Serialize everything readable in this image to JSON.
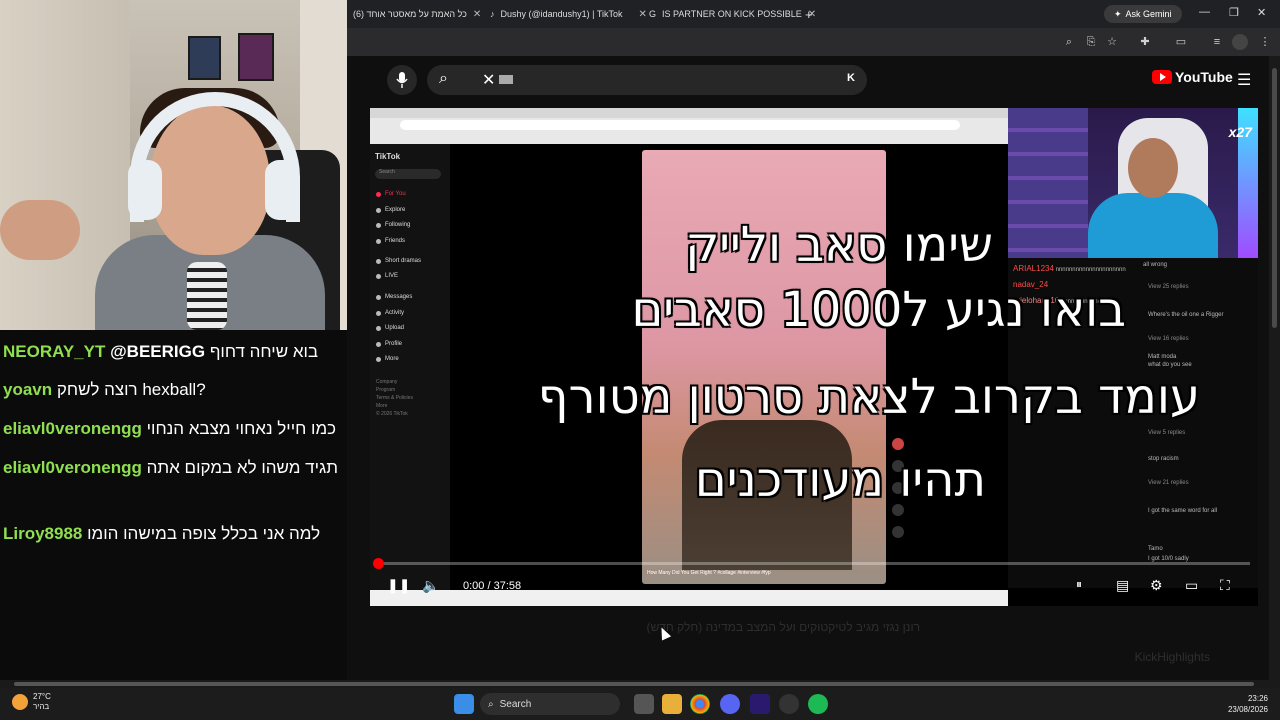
{
  "browser": {
    "tabs": [
      {
        "title": "(6) כל האמת על מאסטר אוחד",
        "close": "✕"
      },
      {
        "title": "Dushy (@idandushy1) | TikTok",
        "close": "✕"
      },
      {
        "title": "IS PARTNER ON KICK POSSIBLE",
        "close": "✕"
      }
    ],
    "new_tab": "+",
    "ask_gemini": "Ask Gemini",
    "window_controls": {
      "minimize": "—",
      "restore": "❐",
      "close": "✕"
    }
  },
  "youtube": {
    "search_key": "K",
    "logo_text": "YouTube"
  },
  "video": {
    "overlay_lines": [
      "שימו סאב ולייק",
      "בואו נגיע ל1000 סאבים",
      "עומד בקרוב לצאת סרטון מטורף",
      "תהיו מעודכנים"
    ],
    "time_display": "0:00 / 37:58",
    "progress_fraction": 0.0,
    "tiktok": {
      "logo": "TikTok",
      "search": "Search",
      "menu": [
        "For You",
        "Explore",
        "Following",
        "Friends",
        "Short dramas",
        "LIVE",
        "Messages",
        "Activity",
        "Upload",
        "Profile",
        "More"
      ],
      "footer": [
        "Company",
        "Program",
        "Terms & Policies",
        "More",
        "© 2026 TikTok"
      ],
      "caption": "How Many Did You Get Right ? #collage #interview #fyp"
    },
    "cam_badge": "x27",
    "kick_chat": [
      {
        "user": "ARIAL1234",
        "text": "nnnnnnnnnnnnnnnnnnnnn"
      },
      {
        "user": "nadav_24",
        "text": ""
      },
      {
        "user": "arielohana10",
        "text": "nnnnnnnnnnnnnnnn"
      },
      {
        "user": "",
        "text": "all wrong"
      },
      {
        "user": "",
        "text": "View 25 replies"
      },
      {
        "user": "",
        "text": "Where's the oil one a Rigger"
      },
      {
        "user": "",
        "text": "View 16 replies"
      },
      {
        "user": "Matt moda",
        "text": "what do you see"
      },
      {
        "user": "",
        "text": "View 5 replies"
      },
      {
        "user": "",
        "text": "stop racism"
      },
      {
        "user": "",
        "text": "View 21 replies"
      },
      {
        "user": "",
        "text": "I got the same word for all"
      },
      {
        "user": "Tamo",
        "text": "I got 10/0 sadly"
      }
    ]
  },
  "stream_chat": [
    {
      "user": "NEORAY_YT",
      "mention": "@BEERIGG",
      "message": "בוא שיחה דחוף"
    },
    {
      "user": "yoavn",
      "mention": "",
      "message": "רוצה לשחק hexball?"
    },
    {
      "user": "eliavl0veronengg",
      "mention": "",
      "message": "כמו חייל נאחוי מצבא הנחוי"
    },
    {
      "user": "eliavl0veronengg",
      "mention": "",
      "message": "תגיד משהו לא במקום אתה"
    },
    {
      "user": "Liroy8988",
      "mention": "",
      "message": "למה אני בכלל צופה במישהו הומו"
    }
  ],
  "below_video": {
    "title": "רונן נגזי מגיב לטיקטוקים ועל המצב במדינה (חלק חדש)",
    "channel": "KickHighlights"
  },
  "taskbar": {
    "temperature": "27°C",
    "weather_desc": "בהיר",
    "search": "Search",
    "time": "23:26",
    "date": "23/08/2026"
  },
  "colors": {
    "chat_username": "#8fdf4f",
    "youtube_red": "#ff0000",
    "kick_name": "#ff4a4a"
  }
}
